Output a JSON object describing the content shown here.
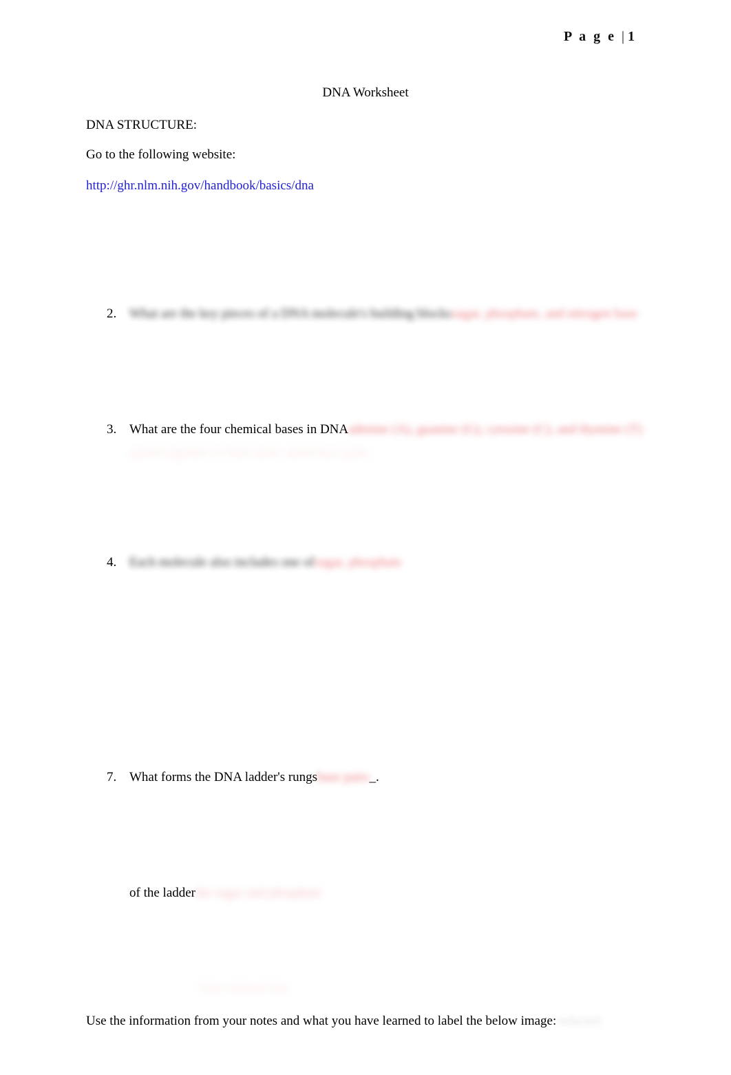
{
  "header": {
    "page_word": "P a g e ",
    "separator": "| ",
    "page_number": "1"
  },
  "document": {
    "title": "DNA Worksheet",
    "structure_heading": "DNA STRUCTURE:",
    "website_prompt": "Go to the following website:",
    "website_url": "http://ghr.nlm.nih.gov/handbook/basics/dna",
    "closing_instruction": "Use the information from your notes and what you have learned to label the below image:",
    "closing_redaction": "redacted"
  },
  "questions": [
    {
      "number": "2.",
      "question_text": "What are the key pieces of a DNA molecule's building blocks",
      "question_redacted": true,
      "answer_text": "sugar, phosphate, and nitrogen base",
      "answer_redacted": true
    },
    {
      "number": "3.",
      "question_text": "What are the four chemical bases in DNA",
      "question_redacted": false,
      "answer_text": "adenine (A), guanine (G), cytosine (C), and thymine (T)",
      "answer_redacted": true,
      "continuation_text": "paired together to form units called base pairs",
      "continuation_redacted": true
    },
    {
      "number": "4.",
      "question_text": "Each molecule also includes one of",
      "question_redacted": true,
      "answer_text": "sugar, phosphate",
      "answer_redacted": true
    },
    {
      "number": "7.",
      "question_text": "What forms the DNA ladder's rungs",
      "question_redacted": false,
      "answer_text": "base pairs",
      "answer_redacted": true,
      "answer_suffix": "_.",
      "continuation_label": "of the ladder",
      "continuation_answer": "the sugar and phosphate",
      "continuation_redacted": true
    }
  ],
  "stray_mark": "faint redacted line",
  "colors": {
    "link": "#2121d6",
    "text": "#000000",
    "answer_red": "#e8555c",
    "paper": "#ffffff"
  }
}
